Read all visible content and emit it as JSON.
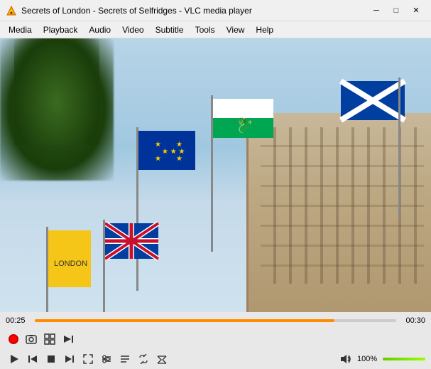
{
  "titleBar": {
    "title": "Secrets of London - Secrets of Selfridges - VLC media player",
    "minLabel": "─",
    "maxLabel": "□",
    "closeLabel": "✕"
  },
  "menuBar": {
    "items": [
      "Media",
      "Playback",
      "Audio",
      "Video",
      "Subtitle",
      "Tools",
      "View",
      "Help"
    ]
  },
  "video": {
    "placeholder": "Video frame"
  },
  "controls": {
    "timeCurrent": "00:25",
    "timeTotal": "00:30",
    "volumePercent": "100%",
    "progressPercent": 83,
    "volumePercent_num": 100
  },
  "buttons": {
    "record": "record",
    "snapshot": "📷",
    "showHide": "⊞",
    "frame": "▶|",
    "play": "▶",
    "prev": "⏮",
    "stop": "■",
    "next": "⏭",
    "fullscreen": "⛶",
    "extended": "⚙",
    "playlist": "☰",
    "loop": "↻",
    "random": "⇄",
    "mute": "🔊"
  }
}
